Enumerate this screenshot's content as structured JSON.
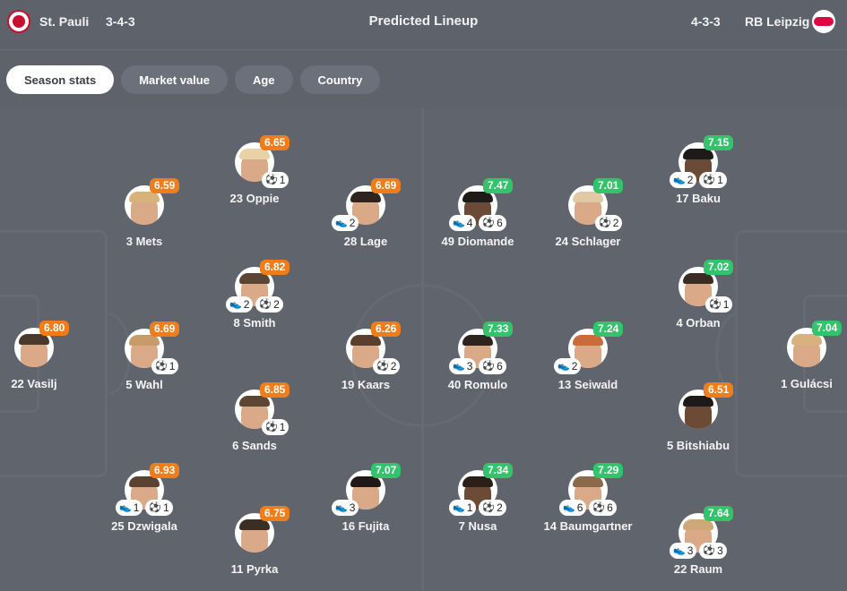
{
  "header": {
    "home_team": "St. Pauli",
    "home_formation": "3-4-3",
    "title": "Predicted Lineup",
    "away_formation": "4-3-3",
    "away_team": "RB Leipzig",
    "home_logo_icon": "st-pauli-crest-icon",
    "away_logo_icon": "rb-leipzig-crest-icon"
  },
  "tabs": [
    {
      "label": "Season stats",
      "active": true
    },
    {
      "label": "Market value",
      "active": false
    },
    {
      "label": "Age",
      "active": false
    },
    {
      "label": "Country",
      "active": false
    }
  ],
  "colors": {
    "rating_orange": "#f07d1a",
    "rating_green": "#33c36b",
    "active_tab": "#ffffff"
  },
  "players": [
    {
      "name": "22 Vasilj",
      "rating": "6.80",
      "rating_color": "orange",
      "assists": null,
      "goals": null
    },
    {
      "name": "3 Mets",
      "rating": "6.59",
      "rating_color": "orange",
      "assists": null,
      "goals": null
    },
    {
      "name": "5 Wahl",
      "rating": "6.69",
      "rating_color": "orange",
      "assists": null,
      "goals": "1"
    },
    {
      "name": "25 Dzwigala",
      "rating": "6.93",
      "rating_color": "orange",
      "assists": "1",
      "goals": "1"
    },
    {
      "name": "23 Oppie",
      "rating": "6.65",
      "rating_color": "orange",
      "assists": null,
      "goals": "1"
    },
    {
      "name": "8 Smith",
      "rating": "6.82",
      "rating_color": "orange",
      "assists": "2",
      "goals": "2"
    },
    {
      "name": "6 Sands",
      "rating": "6.85",
      "rating_color": "orange",
      "assists": null,
      "goals": "1"
    },
    {
      "name": "11 Pyrka",
      "rating": "6.75",
      "rating_color": "orange",
      "assists": null,
      "goals": null
    },
    {
      "name": "28 Lage",
      "rating": "6.69",
      "rating_color": "orange",
      "assists": "2",
      "goals": null
    },
    {
      "name": "19 Kaars",
      "rating": "6.26",
      "rating_color": "orange",
      "assists": null,
      "goals": "2"
    },
    {
      "name": "16 Fujita",
      "rating": "7.07",
      "rating_color": "green",
      "assists": "3",
      "goals": null
    },
    {
      "name": "49 Diomande",
      "rating": "7.47",
      "rating_color": "green",
      "assists": "4",
      "goals": "6"
    },
    {
      "name": "40 Romulo",
      "rating": "7.33",
      "rating_color": "green",
      "assists": "3",
      "goals": "6"
    },
    {
      "name": "7 Nusa",
      "rating": "7.34",
      "rating_color": "green",
      "assists": "1",
      "goals": "2"
    },
    {
      "name": "24 Schlager",
      "rating": "7.01",
      "rating_color": "green",
      "assists": null,
      "goals": "2"
    },
    {
      "name": "13 Seiwald",
      "rating": "7.24",
      "rating_color": "green",
      "assists": "2",
      "goals": null
    },
    {
      "name": "14 Baumgartner",
      "rating": "7.29",
      "rating_color": "green",
      "assists": "6",
      "goals": "6"
    },
    {
      "name": "17 Baku",
      "rating": "7.15",
      "rating_color": "green",
      "assists": "2",
      "goals": "1"
    },
    {
      "name": "4 Orban",
      "rating": "7.02",
      "rating_color": "green",
      "assists": null,
      "goals": "1"
    },
    {
      "name": "5 Bitshiabu",
      "rating": "6.51",
      "rating_color": "orange",
      "assists": null,
      "goals": null
    },
    {
      "name": "22 Raum",
      "rating": "7.64",
      "rating_color": "green",
      "assists": "3",
      "goals": "3"
    },
    {
      "name": "1 Gulácsi",
      "rating": "7.04",
      "rating_color": "green",
      "assists": null,
      "goals": null
    }
  ]
}
